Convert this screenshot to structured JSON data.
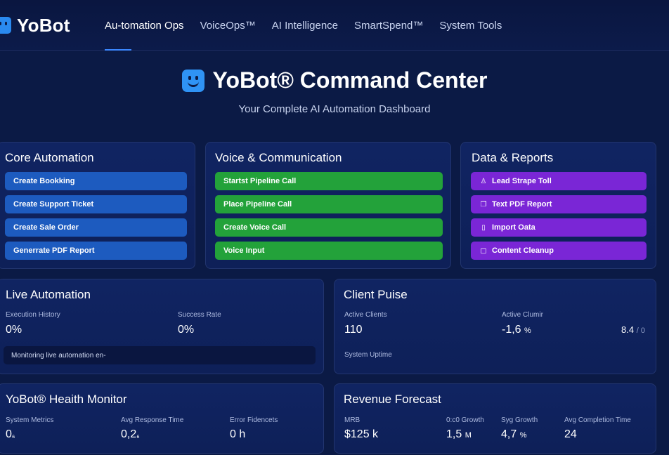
{
  "brand": {
    "name": "YoBot"
  },
  "nav": {
    "items": [
      {
        "label": "Au-tomation Ops",
        "active": true
      },
      {
        "label": "VoiceOps™",
        "active": false
      },
      {
        "label": "AI Intelligence",
        "active": false
      },
      {
        "label": "SmartSpend™",
        "active": false
      },
      {
        "label": "System Tools",
        "active": false
      }
    ]
  },
  "header": {
    "title": "YoBot® Command Center",
    "subtitle": "Your Complete AI Automation Dashboard"
  },
  "core_automation": {
    "title": "Core Automation",
    "buttons": [
      "Create Bookking",
      "Create Support Ticket",
      "Create Sale Order",
      "Generrate PDF Report"
    ]
  },
  "voice": {
    "title": "Voice & Communication",
    "buttons": [
      "Startst Pipeline Call",
      "Place Pipeline Call",
      "Create Voice Call",
      "Voice Input"
    ]
  },
  "data_reports": {
    "title": "Data & Reports",
    "buttons": [
      {
        "label": "Lead Strape Toll",
        "icon": "flask-icon",
        "glyph": "♙"
      },
      {
        "label": "Text PDF Report",
        "icon": "document-icon",
        "glyph": "❐"
      },
      {
        "label": "Import Oata",
        "icon": "import-icon",
        "glyph": "▯"
      },
      {
        "label": "Content Cleanup",
        "icon": "trash-icon",
        "glyph": "▢"
      }
    ]
  },
  "live_automation": {
    "title": "Live Automation",
    "execution_label": "Execution History",
    "execution_value": "0%",
    "success_label": "Success Rate",
    "success_value": "0%",
    "status_text": "Monitoring live autornation en-"
  },
  "client_pulse": {
    "title": "Client Puise",
    "active_clients_label": "Active Clients",
    "active_clients_value": "110",
    "active_clumir_label": "Active Clumir",
    "active_clumir_value": "-1,6",
    "active_clumir_unit": "%",
    "rating_value": "8.4",
    "rating_suffix": "/ 0",
    "uptime_label": "System Uptime"
  },
  "health_monitor": {
    "title": "YoBot® Heaith Monitor",
    "metrics_label": "System Metrics",
    "metrics_value": "0",
    "metrics_unit": "₆",
    "response_label": "Avg Response Time",
    "response_value": "0,2",
    "response_unit": "₆",
    "error_label": "Error Fidencets",
    "error_value": "0 h"
  },
  "revenue": {
    "title": "Revenue Forecast",
    "mrb_label": "MRB",
    "mrb_value": "$125 k",
    "growth_label": "0:c0 Growth",
    "growth_value": "1,5",
    "growth_unit": "M",
    "syg_label": "Syg Growth",
    "syg_value": "4,7",
    "syg_unit": "%",
    "completion_label": "Avg Completion Time",
    "completion_value": "24"
  },
  "colors": {
    "background": "#0b1a45",
    "card": "#102462",
    "blue_button": "#1d5bbf",
    "green_button": "#23a23a",
    "purple_button": "#7a26d6",
    "accent": "#3b86ff"
  }
}
